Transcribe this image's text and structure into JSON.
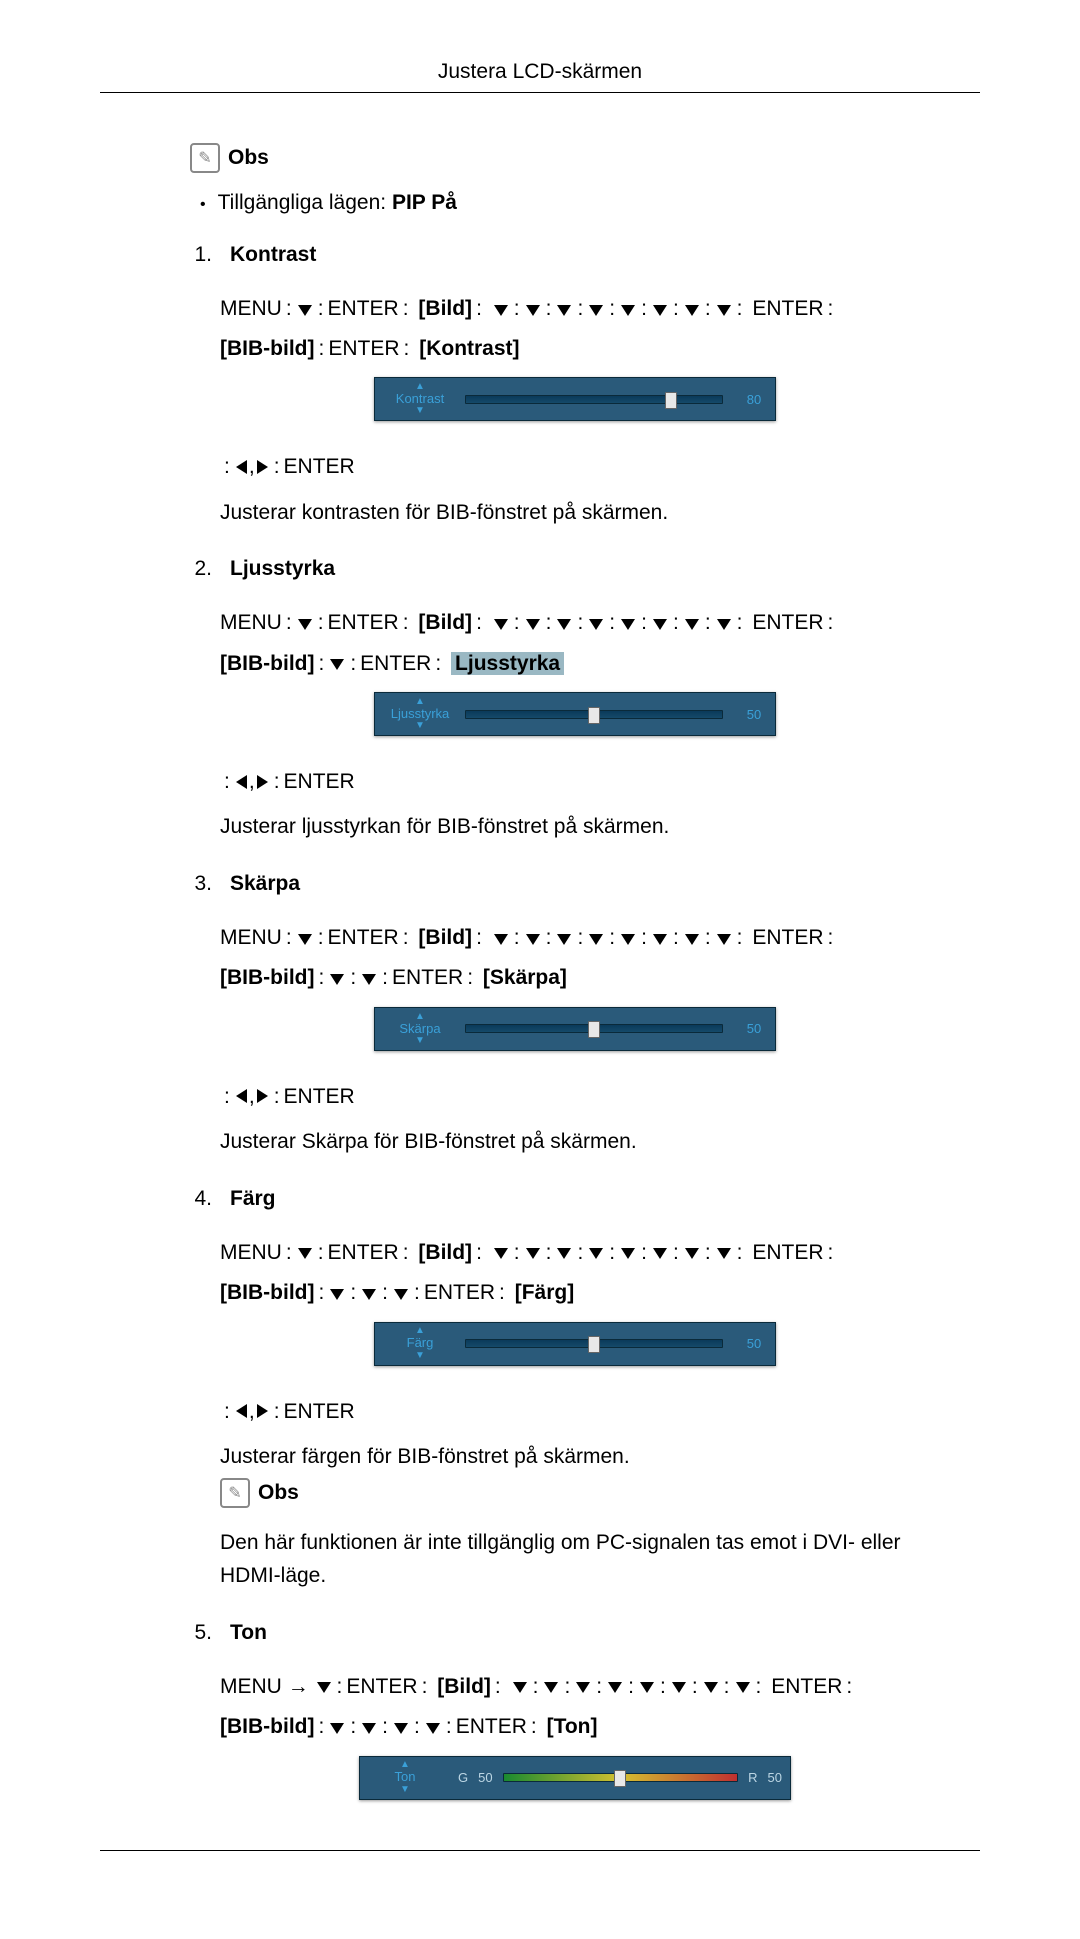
{
  "header": {
    "title": "Justera LCD-skärmen"
  },
  "note_label": "Obs",
  "bullet": {
    "text_prefix": "Tillgängliga lägen:",
    "text_bold": "PIP På"
  },
  "common": {
    "menu": "MENU",
    "enter": "ENTER",
    "arrow": "→",
    "bild": "[Bild]",
    "bib": "[BIB-bild]",
    "nav_suffix": ": ENTER",
    "colon_sep": ":"
  },
  "items": [
    {
      "num": "1.",
      "label": "Kontrast",
      "final_tag": "[Kontrast]",
      "extra_downs_line2": 0,
      "slider": {
        "name": "Kontrast",
        "value": "80",
        "thumb_pct": 80
      },
      "after_text": "Justerar kontrasten för BIB-fönstret på skärmen."
    },
    {
      "num": "2.",
      "label": "Ljusstyrka",
      "final_tag": "Ljusstyrka",
      "final_tag_highlight": true,
      "extra_downs_line2": 1,
      "slider": {
        "name": "Ljusstyrka",
        "value": "50",
        "thumb_pct": 50
      },
      "after_text": "Justerar ljusstyrkan för BIB-fönstret på skärmen."
    },
    {
      "num": "3.",
      "label": "Skärpa",
      "final_tag": "[Skärpa]",
      "extra_downs_line2": 2,
      "slider": {
        "name": "Skärpa",
        "value": "50",
        "thumb_pct": 50
      },
      "after_text": "Justerar Skärpa för BIB-fönstret på skärmen."
    },
    {
      "num": "4.",
      "label": "Färg",
      "final_tag": "[Färg]",
      "extra_downs_line2": 3,
      "slider": {
        "name": "Färg",
        "value": "50",
        "thumb_pct": 50
      },
      "after_text": "Justerar färgen för BIB-fönstret på skärmen.",
      "note_after": "Den här funktionen är inte tillgänglig om PC-signalen tas emot i DVI- eller HDMI-läge."
    },
    {
      "num": "5.",
      "label": "Ton",
      "final_tag": "[Ton]",
      "line1_arrow": true,
      "extra_downs_line2": 4,
      "ton_slider": {
        "name": "Ton",
        "g_label": "G",
        "g_val": "50",
        "r_label": "R",
        "r_val": "50",
        "thumb_pct": 50
      }
    }
  ]
}
